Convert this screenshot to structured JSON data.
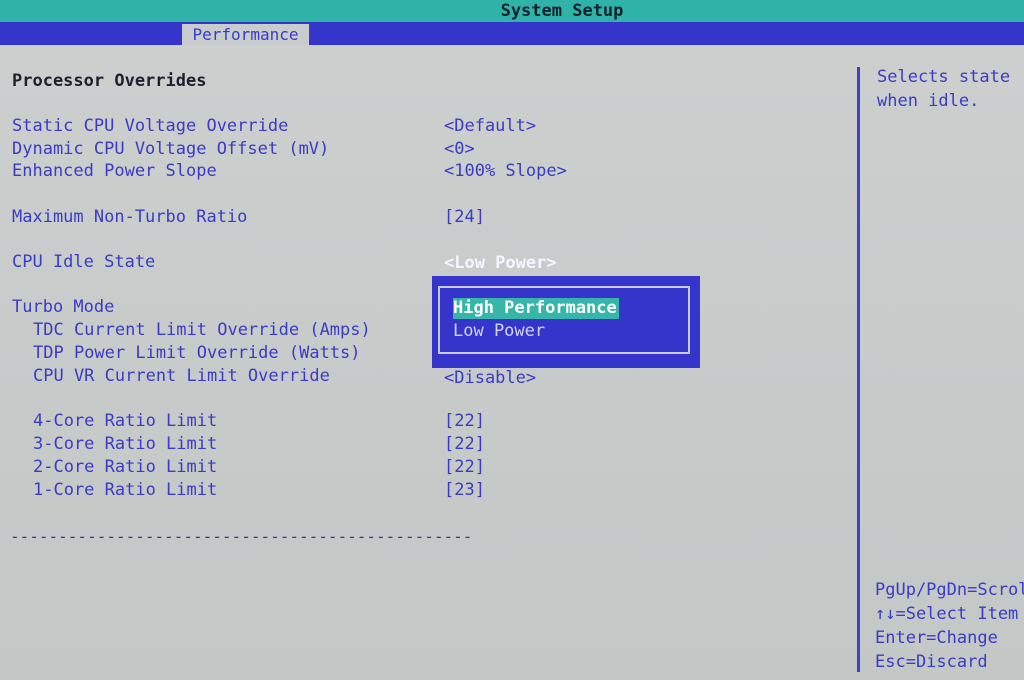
{
  "title": "System Setup",
  "tabs": [
    {
      "label": "Performance",
      "active": true
    }
  ],
  "section_heading": "Processor Overrides",
  "settings": [
    {
      "label": "Static CPU Voltage Override",
      "value": "<Default>"
    },
    {
      "label": "Dynamic CPU Voltage Offset (mV)",
      "value": "<0>"
    },
    {
      "label": "Enhanced Power Slope",
      "value": "<100% Slope>"
    },
    {
      "label": "Maximum Non-Turbo Ratio",
      "value": "[24]"
    },
    {
      "label": "CPU Idle State",
      "value": "<Low Power>"
    },
    {
      "label": "Turbo Mode",
      "value": ""
    },
    {
      "label": "TDC Current Limit Override (Amps)",
      "value": ""
    },
    {
      "label": "TDP Power Limit Override (Watts)",
      "value": ""
    },
    {
      "label": "CPU VR Current Limit Override",
      "value": "<Disable>"
    },
    {
      "label": "4-Core Ratio Limit",
      "value": "[22]"
    },
    {
      "label": "3-Core Ratio Limit",
      "value": "[22]"
    },
    {
      "label": "2-Core Ratio Limit",
      "value": "[22]"
    },
    {
      "label": "1-Core Ratio Limit",
      "value": "[23]"
    }
  ],
  "separator": "------------------------------------------------",
  "popup": {
    "options": [
      "High Performance",
      "Low Power"
    ],
    "selected": "High Performance"
  },
  "help": {
    "description_lines": [
      "Selects state",
      "when idle."
    ],
    "keys": [
      "PgUp/PgDn=Scroll",
      "↑↓=Select Item",
      "Enter=Change",
      "Esc=Discard"
    ]
  },
  "colors": {
    "title_bar": "#2fb3a8",
    "tab_bar": "#3535cc",
    "background": "#c9cccc",
    "text_blue": "#3b3bc6",
    "highlight": "#35b6a8"
  }
}
